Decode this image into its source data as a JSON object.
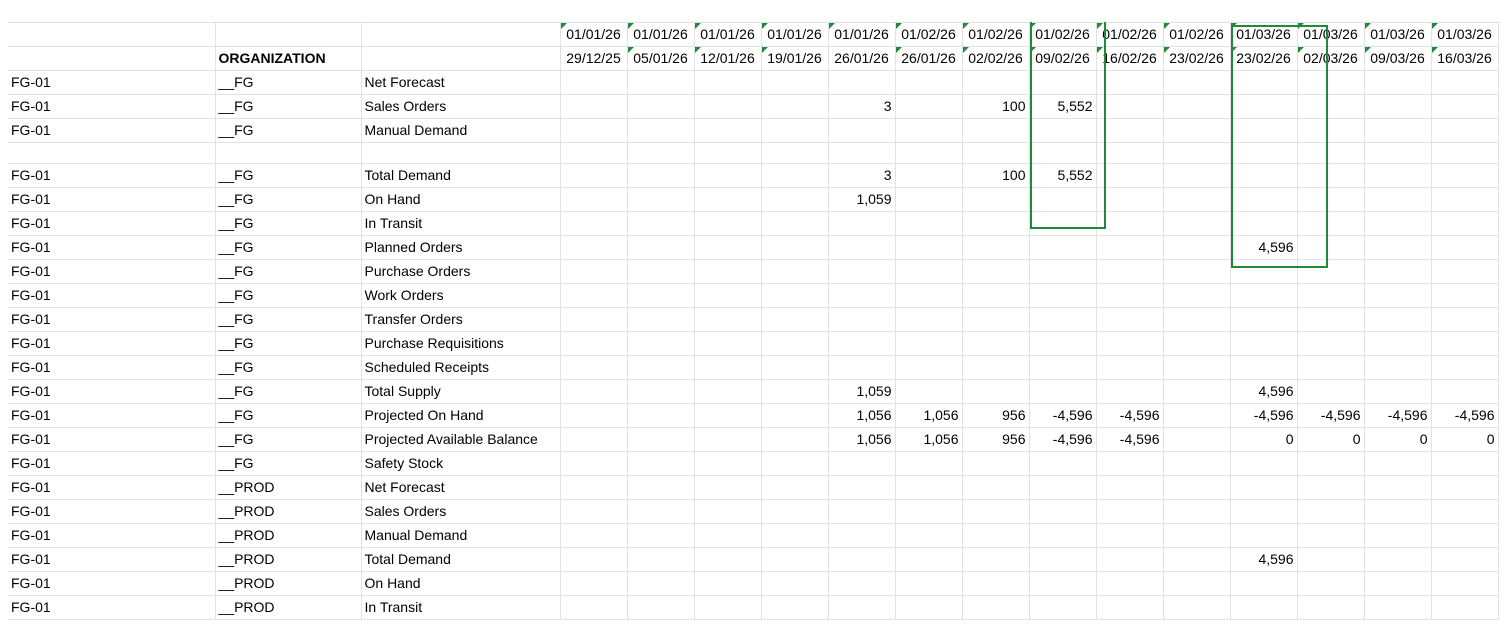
{
  "header": {
    "org_label": "ORGANIZATION",
    "dates_row1": [
      "01/01/26",
      "01/01/26",
      "01/01/26",
      "01/01/26",
      "01/01/26",
      "01/02/26",
      "01/02/26",
      "01/02/26",
      "01/02/26",
      "01/02/26",
      "01/03/26",
      "01/03/26",
      "01/03/26",
      "01/03/26"
    ],
    "dates_row2": [
      "29/12/25",
      "05/01/26",
      "12/01/26",
      "19/01/26",
      "26/01/26",
      "26/01/26",
      "02/02/26",
      "09/02/26",
      "16/02/26",
      "23/02/26",
      "23/02/26",
      "02/03/26",
      "09/03/26",
      "16/03/26"
    ]
  },
  "rows": [
    {
      "item": "FG-01",
      "org": "__FG",
      "measure": "Net Forecast",
      "values": [
        "",
        "",
        "",
        "",
        "",
        "",
        "",
        "",
        "",
        "",
        "",
        "",
        "",
        ""
      ]
    },
    {
      "item": "FG-01",
      "org": "__FG",
      "measure": "Sales Orders",
      "values": [
        "",
        "",
        "",
        "",
        "3",
        "",
        "100",
        "5,552",
        "",
        "",
        "",
        "",
        "",
        ""
      ]
    },
    {
      "item": "FG-01",
      "org": "__FG",
      "measure": "Manual Demand",
      "values": [
        "",
        "",
        "",
        "",
        "",
        "",
        "",
        "",
        "",
        "",
        "",
        "",
        "",
        ""
      ]
    },
    {
      "blank": true
    },
    {
      "item": "FG-01",
      "org": "__FG",
      "measure": "Total Demand",
      "values": [
        "",
        "",
        "",
        "",
        "3",
        "",
        "100",
        "5,552",
        "",
        "",
        "",
        "",
        "",
        ""
      ]
    },
    {
      "item": "FG-01",
      "org": "__FG",
      "measure": "On Hand",
      "values": [
        "",
        "",
        "",
        "",
        "1,059",
        "",
        "",
        "",
        "",
        "",
        "",
        "",
        "",
        ""
      ]
    },
    {
      "item": "FG-01",
      "org": "__FG",
      "measure": "In Transit",
      "values": [
        "",
        "",
        "",
        "",
        "",
        "",
        "",
        "",
        "",
        "",
        "",
        "",
        "",
        ""
      ]
    },
    {
      "item": "FG-01",
      "org": "__FG",
      "measure": "Planned Orders",
      "values": [
        "",
        "",
        "",
        "",
        "",
        "",
        "",
        "",
        "",
        "",
        "4,596",
        "",
        "",
        ""
      ]
    },
    {
      "item": "FG-01",
      "org": "__FG",
      "measure": "Purchase Orders",
      "values": [
        "",
        "",
        "",
        "",
        "",
        "",
        "",
        "",
        "",
        "",
        "",
        "",
        "",
        ""
      ]
    },
    {
      "item": "FG-01",
      "org": "__FG",
      "measure": "Work Orders",
      "values": [
        "",
        "",
        "",
        "",
        "",
        "",
        "",
        "",
        "",
        "",
        "",
        "",
        "",
        ""
      ]
    },
    {
      "item": "FG-01",
      "org": "__FG",
      "measure": "Transfer Orders",
      "values": [
        "",
        "",
        "",
        "",
        "",
        "",
        "",
        "",
        "",
        "",
        "",
        "",
        "",
        ""
      ]
    },
    {
      "item": "FG-01",
      "org": "__FG",
      "measure": "Purchase Requisitions",
      "values": [
        "",
        "",
        "",
        "",
        "",
        "",
        "",
        "",
        "",
        "",
        "",
        "",
        "",
        ""
      ]
    },
    {
      "item": "FG-01",
      "org": "__FG",
      "measure": "Scheduled Receipts",
      "values": [
        "",
        "",
        "",
        "",
        "",
        "",
        "",
        "",
        "",
        "",
        "",
        "",
        "",
        ""
      ]
    },
    {
      "item": "FG-01",
      "org": "__FG",
      "measure": "Total Supply",
      "values": [
        "",
        "",
        "",
        "",
        "1,059",
        "",
        "",
        "",
        "",
        "",
        "4,596",
        "",
        "",
        ""
      ]
    },
    {
      "item": "FG-01",
      "org": "__FG",
      "measure": "Projected On Hand",
      "values": [
        "",
        "",
        "",
        "",
        "1,056",
        "1,056",
        "956",
        "-4,596",
        "-4,596",
        "",
        "-4,596",
        "-4,596",
        "-4,596",
        "-4,596"
      ]
    },
    {
      "item": "FG-01",
      "org": "__FG",
      "measure": "Projected Available Balance",
      "values": [
        "",
        "",
        "",
        "",
        "1,056",
        "1,056",
        "956",
        "-4,596",
        "-4,596",
        "",
        "0",
        "0",
        "0",
        "0"
      ]
    },
    {
      "item": "FG-01",
      "org": "__FG",
      "measure": "Safety Stock",
      "values": [
        "",
        "",
        "",
        "",
        "",
        "",
        "",
        "",
        "",
        "",
        "",
        "",
        "",
        ""
      ]
    },
    {
      "item": "FG-01",
      "org": "__PROD",
      "measure": "Net Forecast",
      "values": [
        "",
        "",
        "",
        "",
        "",
        "",
        "",
        "",
        "",
        "",
        "",
        "",
        "",
        ""
      ]
    },
    {
      "item": "FG-01",
      "org": "__PROD",
      "measure": "Sales Orders",
      "values": [
        "",
        "",
        "",
        "",
        "",
        "",
        "",
        "",
        "",
        "",
        "",
        "",
        "",
        ""
      ]
    },
    {
      "item": "FG-01",
      "org": "__PROD",
      "measure": "Manual Demand",
      "values": [
        "",
        "",
        "",
        "",
        "",
        "",
        "",
        "",
        "",
        "",
        "",
        "",
        "",
        ""
      ]
    },
    {
      "item": "FG-01",
      "org": "__PROD",
      "measure": "Total Demand",
      "values": [
        "",
        "",
        "",
        "",
        "",
        "",
        "",
        "",
        "",
        "",
        "4,596",
        "",
        "",
        ""
      ]
    },
    {
      "item": "FG-01",
      "org": "__PROD",
      "measure": "On Hand",
      "values": [
        "",
        "",
        "",
        "",
        "",
        "",
        "",
        "",
        "",
        "",
        "",
        "",
        "",
        ""
      ]
    },
    {
      "item": "FG-01",
      "org": "__PROD",
      "measure": "In Transit",
      "values": [
        "",
        "",
        "",
        "",
        "",
        "",
        "",
        "",
        "",
        "",
        "",
        "",
        "",
        ""
      ]
    }
  ],
  "colors": {
    "accent": "#1e8a3a",
    "grid": "#e1e1e1"
  }
}
